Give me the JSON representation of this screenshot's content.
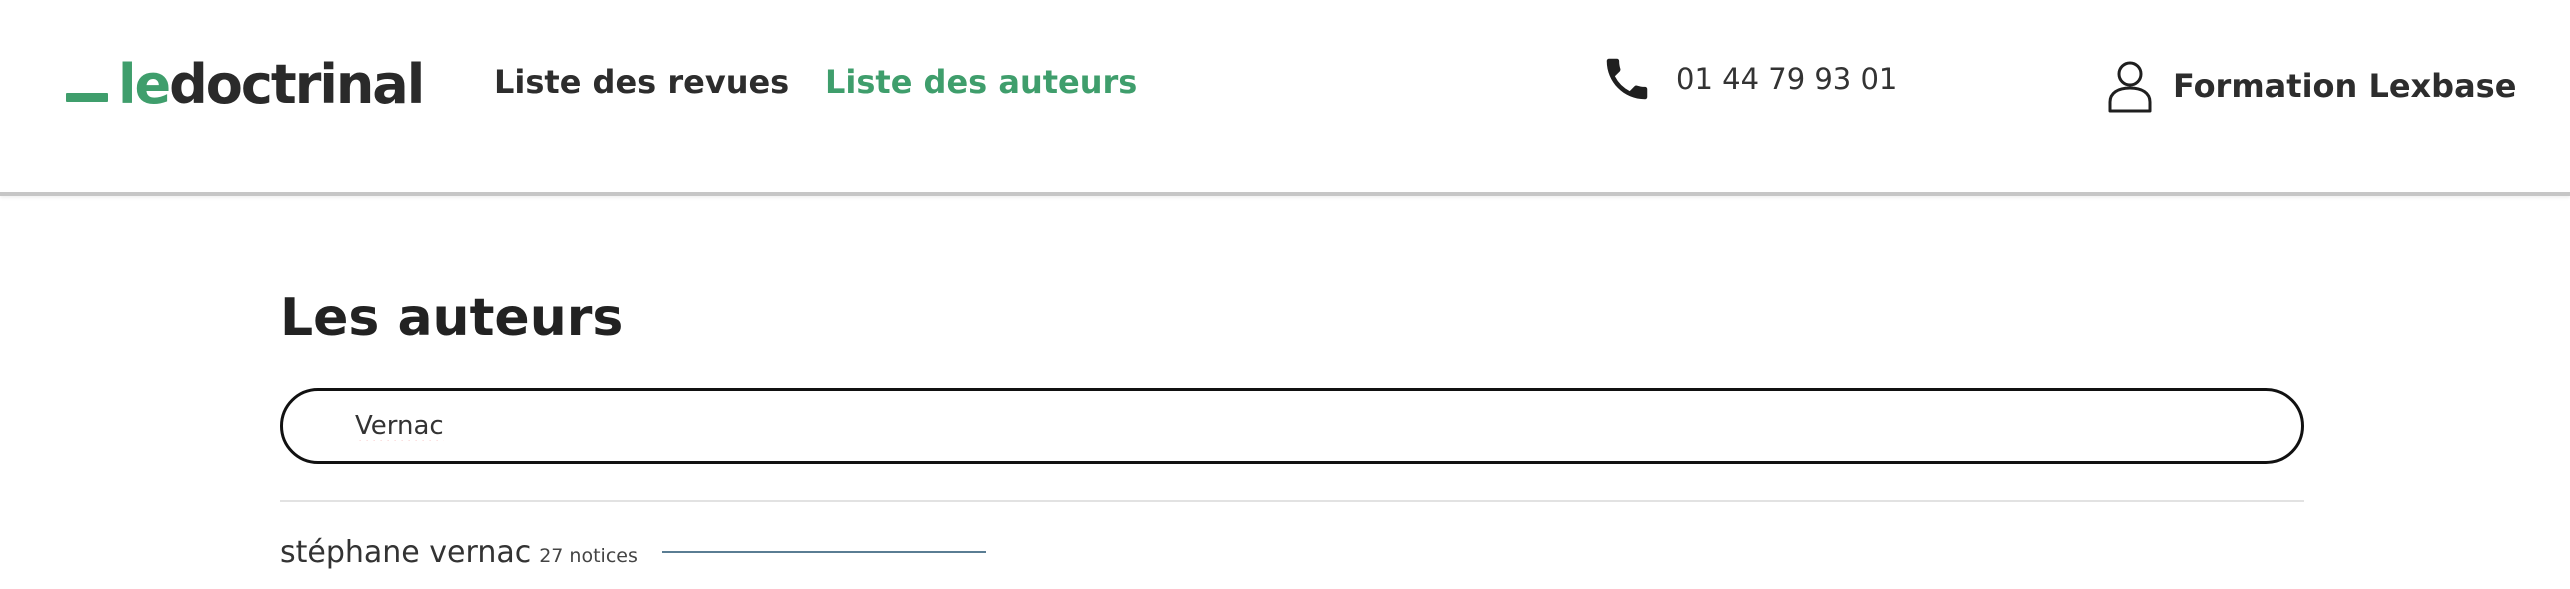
{
  "header": {
    "logo": {
      "prefix": "le",
      "rest": "doctrinal",
      "accent_color": "#3f9e6c"
    },
    "nav": [
      {
        "label": "Liste des revues",
        "active": false
      },
      {
        "label": "Liste des auteurs",
        "active": true
      }
    ],
    "phone": {
      "icon": "phone-icon",
      "number": "01 44 79 93 01"
    },
    "account": {
      "icon": "user-icon",
      "label": "Formation Lexbase"
    }
  },
  "main": {
    "title": "Les auteurs",
    "search": {
      "value": "Vernac",
      "placeholder": ""
    },
    "results": [
      {
        "name": "stéphane vernac",
        "count": "27 notices"
      }
    ]
  }
}
